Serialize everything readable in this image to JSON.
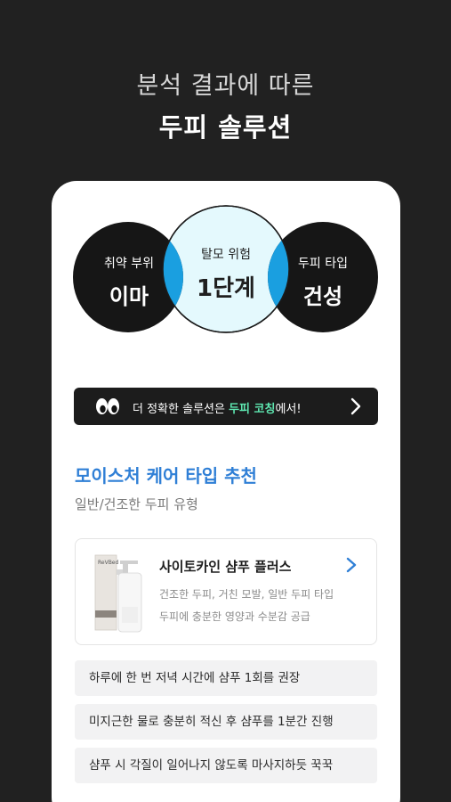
{
  "header": {
    "subtitle": "분석 결과에 따른",
    "title": "두피 솔루션"
  },
  "diagnosis": {
    "left": {
      "label": "취약 부위",
      "value": "이마"
    },
    "middle": {
      "label": "탈모 위험",
      "value": "1단계"
    },
    "right": {
      "label": "두피 타입",
      "value": "건성"
    }
  },
  "coaching": {
    "text_before": "더 정확한 솔루션은 ",
    "highlight": "두피 코칭",
    "text_after": "에서!"
  },
  "recommendation": {
    "title": "모이스처 케어 타입 추천",
    "subtitle": "일반/건조한 두피 유형"
  },
  "product": {
    "brand": "ReVBed",
    "name": "사이토카인 샴푸 플러스",
    "desc1": "건조한 두피, 거친 모발, 일반 두피 타입",
    "desc2": "두피에 충분한 영양과 수분감 공급"
  },
  "tips": [
    "하루에 한 번 저녁 시간에 샴푸 1회를 권장",
    "미지근한 물로 충분히 적신 후 샴푸를 1분간 진행",
    "샴푸 시 각질이 일어나지 않도록 마사지하듯 꾹꾹"
  ],
  "colors": {
    "background": "#212121",
    "accent_blue": "#2f7fd6",
    "overlap_blue": "#1a9fe0",
    "center_fill": "#e4f9fd",
    "highlight_green": "#5ee6b0"
  }
}
